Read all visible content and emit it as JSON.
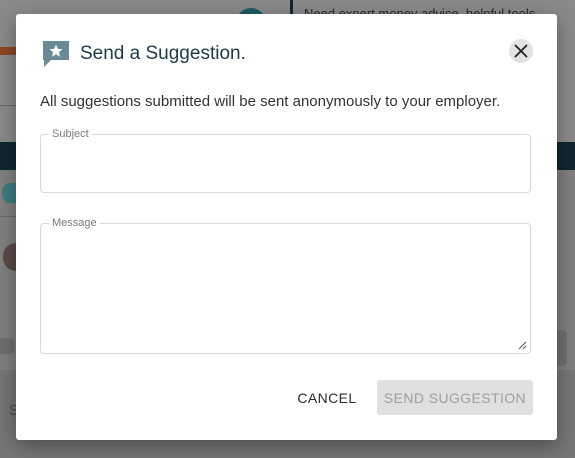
{
  "background": {
    "teaser_text": "Need expert money advice, helpful tools",
    "partial_letter": "S"
  },
  "dialog": {
    "title": "Send a Suggestion.",
    "icon": "chat-star-icon",
    "close_icon": "close-icon",
    "subtitle": "All suggestions submitted will be sent anonymously to your employer.",
    "subject": {
      "label": "Subject",
      "value": ""
    },
    "message": {
      "label": "Message",
      "value": ""
    },
    "cancel_label": "CANCEL",
    "send_label": "SEND SUGGESTION"
  },
  "colors": {
    "title": "#1d3b47",
    "icon": "#6a8a96",
    "overlay": "#7f7f7f",
    "button_disabled_bg": "#e0e0e0",
    "button_disabled_text": "#9e9e9e"
  }
}
